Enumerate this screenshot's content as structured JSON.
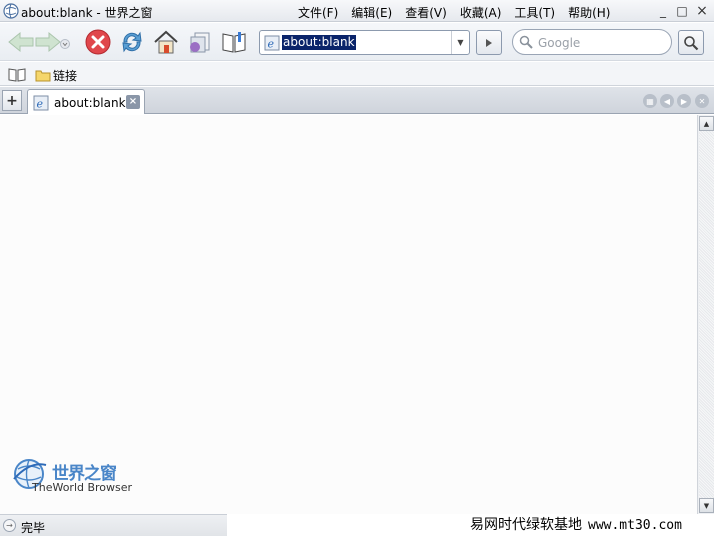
{
  "window": {
    "title": "about:blank - 世界之窗",
    "controls": {
      "minimize": "_",
      "maximize": "□",
      "close": "×"
    }
  },
  "menu": {
    "items": [
      {
        "label": "文件(F)"
      },
      {
        "label": "编辑(E)"
      },
      {
        "label": "查看(V)"
      },
      {
        "label": "收藏(A)"
      },
      {
        "label": "工具(T)"
      },
      {
        "label": "帮助(H)"
      }
    ]
  },
  "toolbar": {
    "buttons": [
      "back-icon",
      "forward-icon",
      "stop-icon",
      "refresh-icon",
      "home-icon",
      "restore-icon",
      "favorites-icon"
    ],
    "address_value": "about:blank",
    "search_placeholder": "Google"
  },
  "linkbar": {
    "folder_label": "链接"
  },
  "tabs": {
    "items": [
      {
        "label": "about:blank",
        "active": true
      }
    ]
  },
  "content": {
    "logo_cn": "世界之窗",
    "logo_en": "TheWorld Browser"
  },
  "status": {
    "text": "完毕"
  },
  "watermark": {
    "cn": "易网时代绿软基地",
    "url": "www.mt30.com"
  },
  "colors": {
    "accent": "#4a86c8",
    "selection": "#0a246a",
    "stop_red": "#e0474c"
  }
}
